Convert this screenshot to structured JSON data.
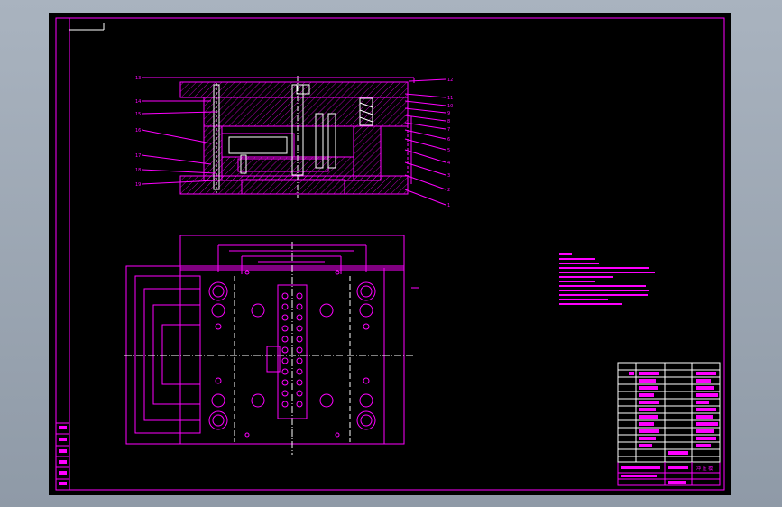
{
  "colors": {
    "background": "#000000",
    "line": "#ff00ff",
    "hidden": "#ffffff",
    "window_bg": "#a9b3bf"
  },
  "section_view": {
    "left_callouts": [
      "13",
      "14",
      "15",
      "16",
      "17",
      "18",
      "19"
    ],
    "right_callouts": [
      "12",
      "11",
      "10",
      "9",
      "8",
      "7",
      "6",
      "5",
      "4",
      "3",
      "2",
      "1"
    ]
  },
  "title_block": {
    "title_label": "冲 压 模"
  }
}
